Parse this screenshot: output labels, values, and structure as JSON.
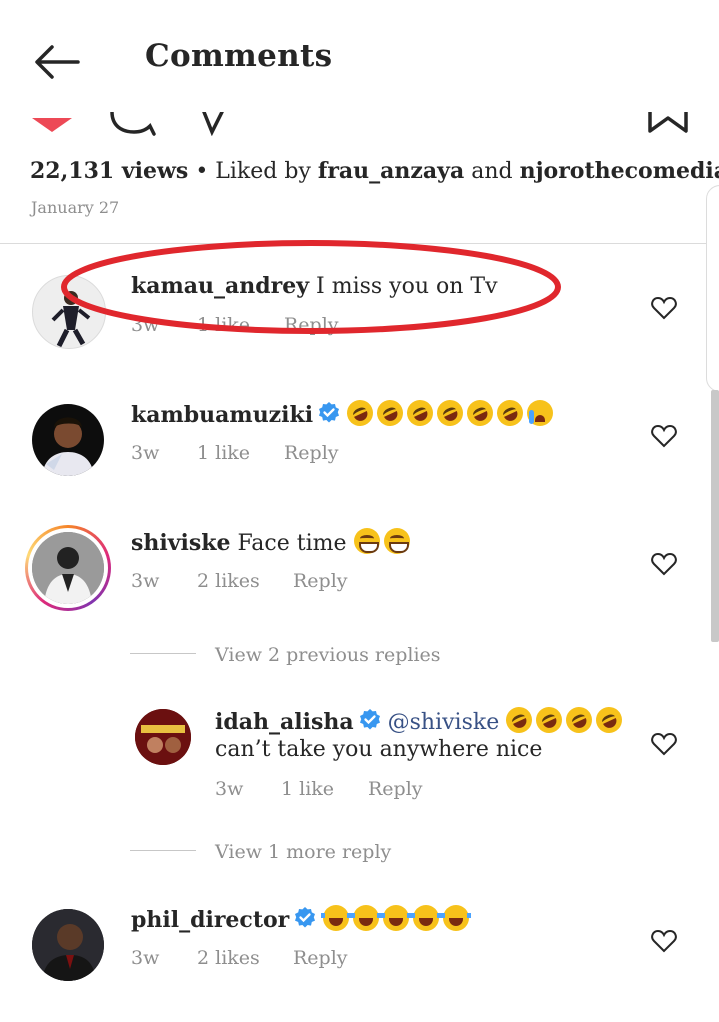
{
  "header": {
    "title": "Comments"
  },
  "post": {
    "views": "22,131 views",
    "liked_by_prefix": " • Liked by ",
    "liked_by_user1": "frau_anzaya",
    "liked_by_and": " and ",
    "liked_by_user2": "njorothecomedian",
    "date": "January 27"
  },
  "comments": [
    {
      "username": "kamau_andrey",
      "text": "I miss you on Tv",
      "time": "3w",
      "likes": "1 like",
      "reply": "Reply"
    },
    {
      "username": "kambuamuziki",
      "verified": true,
      "time": "3w",
      "likes": "1 like",
      "reply": "Reply"
    },
    {
      "username": "shiviske",
      "text": "Face time",
      "time": "3w",
      "likes": "2 likes",
      "reply": "Reply"
    },
    {
      "username": "phil_director",
      "verified": true,
      "time": "3w",
      "likes": "2 likes",
      "reply": "Reply"
    }
  ],
  "replies": {
    "view_previous": "View 2 previous replies",
    "view_more": "View 1 more reply",
    "items": [
      {
        "username": "idah_alisha",
        "verified": true,
        "mention": "@shiviske",
        "text_line2": "can’t take you anywhere nice",
        "time": "3w",
        "likes": "1 like",
        "reply": "Reply"
      }
    ]
  },
  "colors": {
    "verified": "#3897f0",
    "annotation": "#e0272d",
    "meta": "#8e8e8e",
    "heart_top": "#ed4956"
  },
  "icons": [
    "back-arrow-icon",
    "heart-icon",
    "comment-icon",
    "share-icon",
    "bookmark-icon",
    "verified-icon"
  ]
}
